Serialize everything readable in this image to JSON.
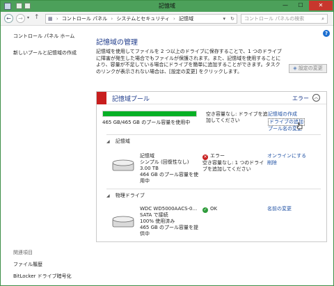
{
  "window": {
    "title": "記憶域",
    "minimize": "—",
    "maximize": "☐",
    "close": "✕"
  },
  "address": {
    "back": "←",
    "forward": "→",
    "up": "↑",
    "crumbs": [
      "コントロール パネル",
      "システムとセキュリティ",
      "記憶域"
    ],
    "search_placeholder": "コントロール パネルの検索"
  },
  "leftnav": {
    "home": "コントロール パネル ホーム",
    "create": "新しいプールと記憶域の作成"
  },
  "related": {
    "header": "関連項目",
    "file_history": "ファイル履歴",
    "bitlocker": "BitLocker ドライブ暗号化"
  },
  "main": {
    "title": "記憶域の管理",
    "intro": "記憶域を使用してファイルを 2 つ以上のドライブに保存することで、1 つのドライブに障害が発生した場合でもファイルが保護されます。また、記憶域を使用することにより、容量が不足している場合にドライブを簡単に追加することができます。タスクのリンクが表示されない場合は、[設定の変更] をクリックします。",
    "settings_button": "設定の変更"
  },
  "pool": {
    "title": "記憶域プール",
    "status": "エラー",
    "usage_fraction": 1.0,
    "usage_text": "465 GB/465 GB のプール容量を使用中",
    "status_msg": "空き容量なし: ドライブを追加してください",
    "links": {
      "create": "記憶域の作成",
      "add_drive": "ドライブの追加",
      "rename_pool": "プール名の変更"
    }
  },
  "spaces_section": {
    "header": "記憶域",
    "item": {
      "name": "記憶域",
      "layout": "シンプル (回復性なし)",
      "size": "3.00 TB",
      "usage": "464 GB のプール容量を使用中",
      "state_label": "エラー",
      "state_msg": "空き容量なし: 1 つのドライブを追加してください",
      "link_online": "オンラインにする",
      "link_delete": "削除"
    }
  },
  "drives_section": {
    "header": "物理ドライブ",
    "item": {
      "name": "WDC WD5000AACS-0...",
      "bus": "SATA で接続",
      "used": "100% 使用済み",
      "provides": "465 GB のプール容量を提供中",
      "state_label": "OK",
      "link_rename": "名前の変更"
    }
  },
  "colors": {
    "titlebar": "#4ca05a",
    "link": "#1d4fa3",
    "heading": "#1d3a8a",
    "error": "#c81e1e",
    "ok": "#2e9b3a",
    "bar_fill": "#06b025"
  }
}
